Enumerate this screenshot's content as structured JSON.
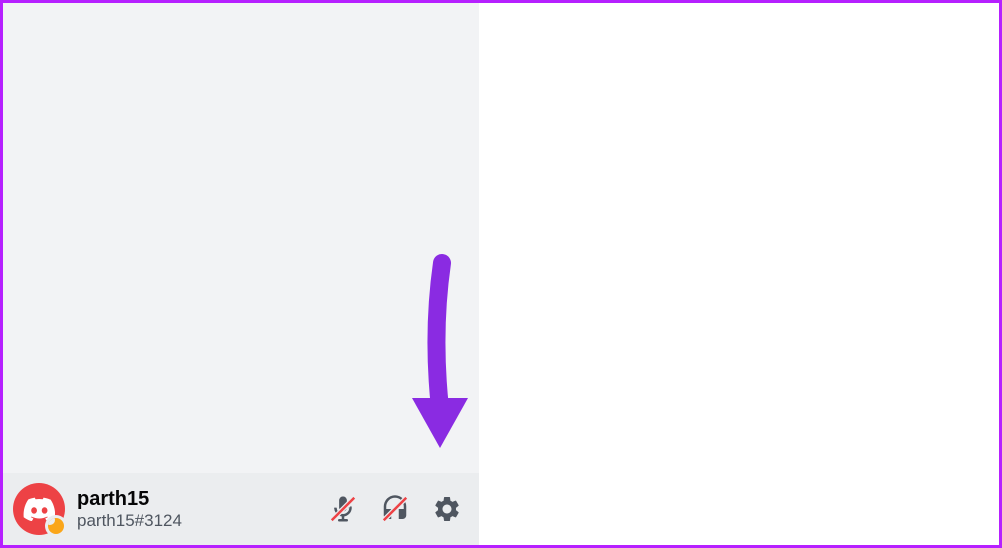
{
  "user": {
    "username": "parth15",
    "tag": "parth15#3124",
    "status": "idle"
  },
  "colors": {
    "accent": "#8a2be2",
    "avatar_bg": "#ed4245",
    "status_idle": "#faa61a",
    "border": "#b620ff"
  },
  "icons": {
    "mute": "microphone-muted-icon",
    "deafen": "headphones-muted-icon",
    "settings": "gear-icon"
  }
}
